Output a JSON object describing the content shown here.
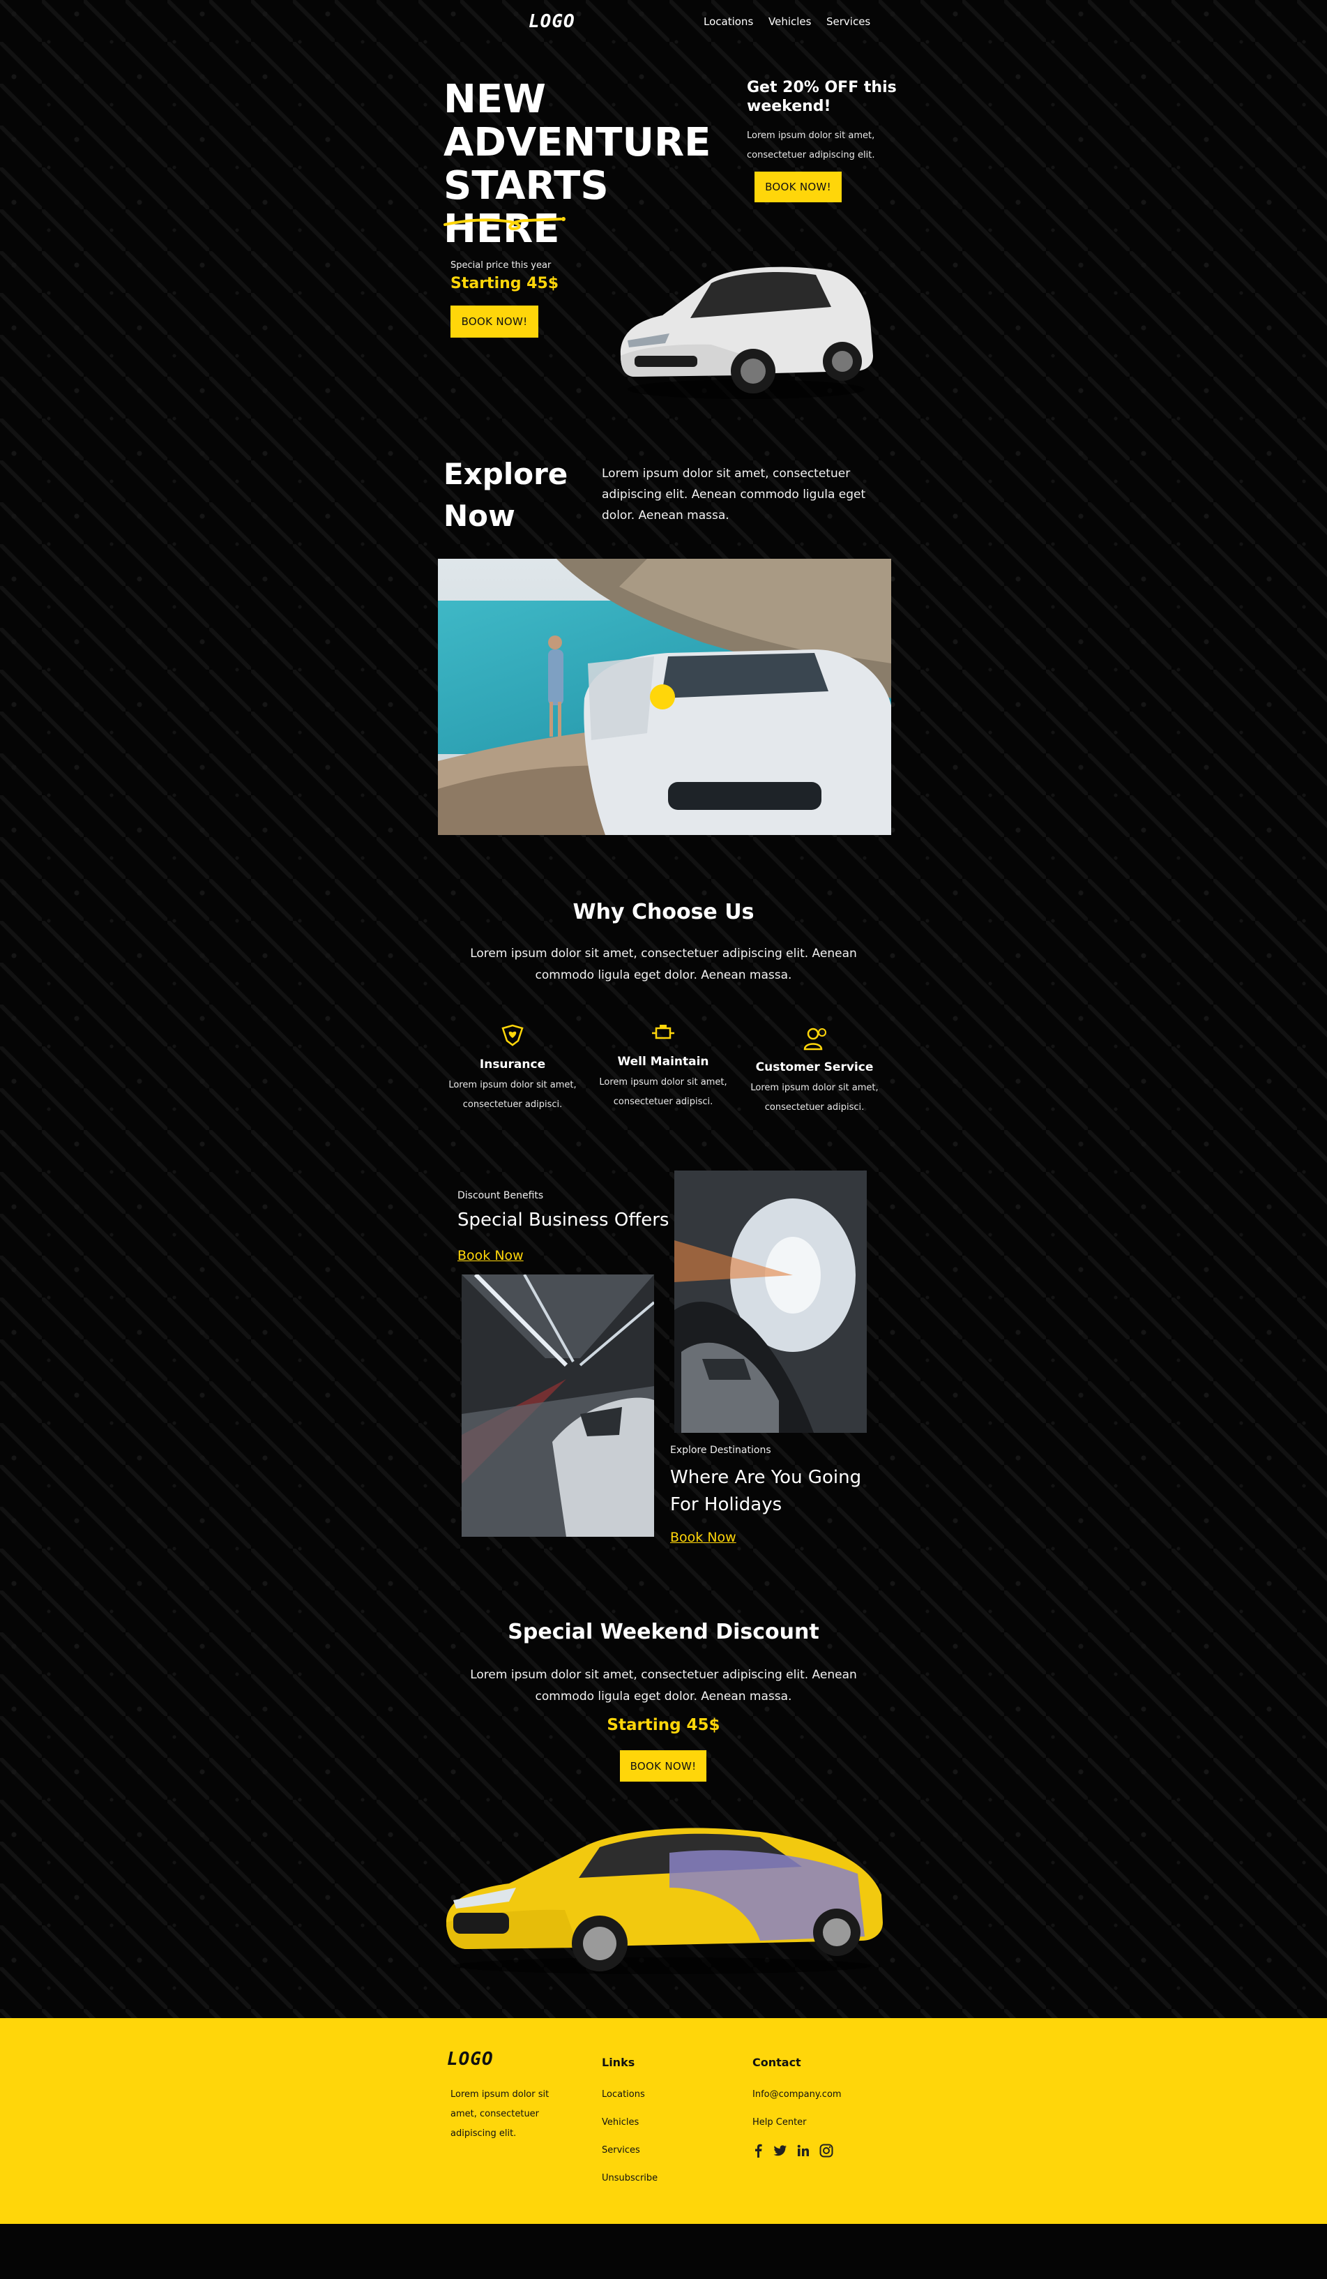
{
  "header": {
    "logo": "LOGO",
    "nav": [
      "Locations",
      "Vehicles",
      "Services"
    ]
  },
  "hero": {
    "title_lines": [
      "NEW",
      "ADVENTURE",
      "STARTS HERE"
    ],
    "promo_title": "Get 20% OFF this weekend!",
    "promo_text": "Lorem ipsum dolor sit amet, consectetuer adipiscing elit.",
    "promo_button": "BOOK NOW!",
    "special_label": "Special price this year",
    "starting_price": "Starting 45$",
    "book_button": "BOOK NOW!"
  },
  "explore": {
    "title_lines": [
      "Explore",
      "Now"
    ],
    "text": "Lorem ipsum dolor sit amet, consectetuer adipiscing elit. Aenean commodo ligula eget dolor. Aenean massa."
  },
  "why": {
    "title": "Why Choose Us",
    "text": "Lorem ipsum dolor sit amet, consectetuer adipiscing elit. Aenean commodo ligula eget dolor. Aenean massa.",
    "features": [
      {
        "icon": "shield-heart-icon",
        "title": "Insurance",
        "desc": "Lorem ipsum dolor sit amet, consectetuer adipisci."
      },
      {
        "icon": "engine-icon",
        "title": "Well Maintain",
        "desc": "Lorem ipsum dolor sit amet, consectetuer adipisci."
      },
      {
        "icon": "customer-service-icon",
        "title": "Customer Service",
        "desc": "Lorem ipsum dolor sit amet, consectetuer adipisci."
      }
    ]
  },
  "offers": {
    "business": {
      "label": "Discount Benefits",
      "title": "Special Business Offers",
      "link": "Book Now"
    },
    "destinations": {
      "label": "Explore Destinations",
      "title_lines": [
        "Where Are You Going",
        "For Holidays"
      ],
      "link": "Book Now"
    }
  },
  "weekend": {
    "title": "Special Weekend Discount",
    "text": "Lorem ipsum dolor sit amet, consectetuer adipiscing elit. Aenean commodo ligula eget dolor. Aenean massa.",
    "price": "Starting 45$",
    "button": "BOOK NOW!"
  },
  "footer": {
    "logo": "LOGO",
    "about": "Lorem ipsum dolor sit amet, consectetuer adipiscing elit.",
    "links_title": "Links",
    "links": [
      "Locations",
      "Vehicles",
      "Services",
      "Unsubscribe"
    ],
    "contact_title": "Contact",
    "email": "Info@company.com",
    "help": "Help Center",
    "social": [
      "facebook-icon",
      "twitter-icon",
      "linkedin-icon",
      "instagram-icon"
    ]
  },
  "colors": {
    "accent": "#ffd60a",
    "background": "#050505"
  }
}
